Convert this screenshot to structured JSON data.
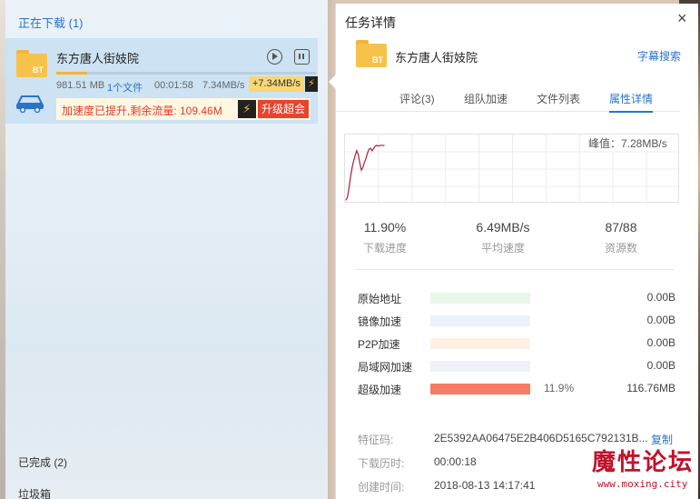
{
  "left_panel": {
    "downloading_title": "正在下载 (1)",
    "completed_title": "已完成 (2)",
    "trash_title": "垃圾箱",
    "task": {
      "name": "东方唐人街妓院",
      "folder_badge": "BT",
      "progress_fraction": 0.119,
      "size": "981.51 MB",
      "files": "1个文件",
      "elapsed": "00:01:58",
      "speed": "7.34MB/s",
      "boost_speed": "+7.34MB/s",
      "bolt": "⚡",
      "boost_message": "加速度已提升,剩余流量:  109.46M",
      "upgrade_label": "升级超会",
      "icons": [
        "folder-icon",
        "play-icon",
        "pause-icon",
        "car-icon",
        "bolt-icon"
      ]
    }
  },
  "details": {
    "title": "任务详情",
    "close": "×",
    "task_name": "东方唐人街妓院",
    "folder_badge": "BT",
    "subtitle_search": "字幕搜索",
    "tabs": [
      {
        "label": "评论(3)",
        "active": false
      },
      {
        "label": "组队加速",
        "active": false
      },
      {
        "label": "文件列表",
        "active": false
      },
      {
        "label": "属性详情",
        "active": true
      }
    ],
    "peak": "峰值：7.28MB/s",
    "stats": {
      "progress_value": "11.90%",
      "progress_label": "下载进度",
      "avg_speed_value": "6.49MB/s",
      "avg_speed_label": "平均速度",
      "sources_value": "87/88",
      "sources_label": "资源数"
    },
    "sources": [
      {
        "label": "原始地址",
        "bytes": "0.00B",
        "pct": "",
        "fraction": 0,
        "track_color": "#e8f6e6",
        "fill_color": "#9fd98f"
      },
      {
        "label": "镜像加速",
        "bytes": "0.00B",
        "pct": "",
        "fraction": 0,
        "track_color": "#eaf3fb",
        "fill_color": "#8fc1ee"
      },
      {
        "label": "P2P加速",
        "bytes": "0.00B",
        "pct": "",
        "fraction": 0,
        "track_color": "#fdf1e3",
        "fill_color": "#f3b96f"
      },
      {
        "label": "局域网加速",
        "bytes": "0.00B",
        "pct": "",
        "fraction": 0,
        "track_color": "#eef1f8",
        "fill_color": "#9aa9d8"
      },
      {
        "label": "超级加速",
        "bytes": "116.76MB",
        "pct": "11.9%",
        "fraction": 1,
        "track_color": "#fde3dc",
        "fill_color": "#f47d63"
      }
    ],
    "info": {
      "hash_label": "特征码:",
      "hash_value": "2E5392AA06475E2B406D5165C792131B...",
      "copy": "复制",
      "elapsed_label": "下载历时:",
      "elapsed_value": "00:00:18",
      "created_label": "创建时间:",
      "created_value": "2018-08-13 14:17:41"
    }
  },
  "chart_data": {
    "type": "line",
    "peak_label": "峰值：7.28MB/s",
    "y_unit": "MB/s",
    "ylim": [
      0,
      7.28
    ],
    "values": [
      0.2,
      0.6,
      1.8,
      3.2,
      4.4,
      5.3,
      6.0,
      6.6,
      6.1,
      5.0,
      4.1,
      4.4,
      5.1,
      5.6,
      6.3,
      6.8,
      6.9,
      6.6,
      6.9,
      7.2,
      7.28,
      7.2,
      7.28,
      7.28,
      7.28,
      7.28
    ],
    "line_color": "#b5294b",
    "grid": true
  },
  "watermark": {
    "text": "魔性论坛",
    "url": "www.moxing.city"
  }
}
